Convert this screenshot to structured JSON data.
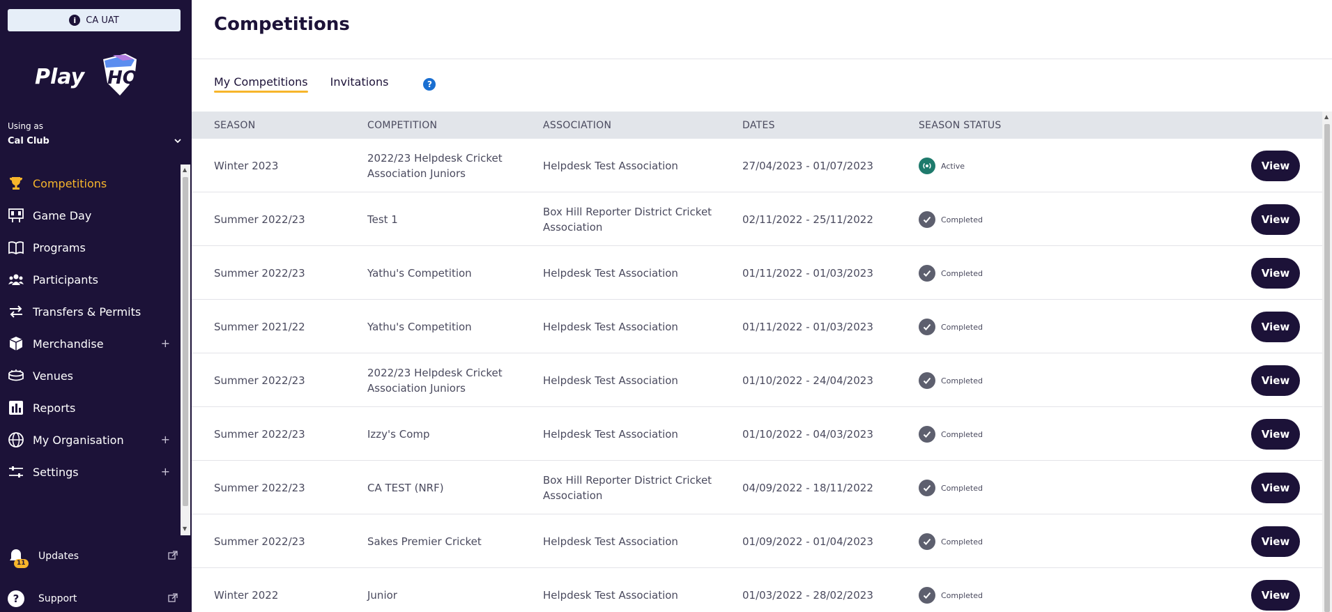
{
  "env": {
    "label": "CA UAT"
  },
  "brand": {
    "logo_text": "PlayHQ"
  },
  "account": {
    "using_as_label": "Using as",
    "club_name": "Cal Club"
  },
  "sidebar": {
    "items": [
      {
        "label": "Competitions",
        "icon": "trophy-icon",
        "active": true
      },
      {
        "label": "Game Day",
        "icon": "scoreboard-icon"
      },
      {
        "label": "Programs",
        "icon": "book-icon"
      },
      {
        "label": "Participants",
        "icon": "people-icon"
      },
      {
        "label": "Transfers & Permits",
        "icon": "transfer-arrows-icon"
      },
      {
        "label": "Merchandise",
        "icon": "boxes-icon",
        "expand": "+"
      },
      {
        "label": "Venues",
        "icon": "stadium-icon"
      },
      {
        "label": "Reports",
        "icon": "chart-icon"
      },
      {
        "label": "My Organisation",
        "icon": "globe-icon",
        "expand": "+"
      },
      {
        "label": "Settings",
        "icon": "sliders-icon",
        "expand": "+"
      }
    ],
    "bottom": {
      "updates_label": "Updates",
      "updates_count": "11",
      "support_label": "Support"
    }
  },
  "page": {
    "title": "Competitions",
    "tabs": [
      {
        "label": "My Competitions",
        "active": true
      },
      {
        "label": "Invitations"
      }
    ],
    "help_glyph": "?"
  },
  "table": {
    "headers": {
      "season": "SEASON",
      "competition": "COMPETITION",
      "association": "ASSOCIATION",
      "dates": "DATES",
      "status": "SEASON STATUS"
    },
    "view_label": "View",
    "rows": [
      {
        "season": "Winter 2023",
        "competition": "2022/23 Helpdesk Cricket Association Juniors",
        "association": "Helpdesk Test Association",
        "dates": "27/04/2023 - 01/07/2023",
        "status": "Active"
      },
      {
        "season": "Summer 2022/23",
        "competition": "Test 1",
        "association": "Box Hill Reporter District Cricket Association",
        "dates": "02/11/2022 - 25/11/2022",
        "status": "Completed"
      },
      {
        "season": "Summer 2022/23",
        "competition": "Yathu's Competition",
        "association": "Helpdesk Test Association",
        "dates": "01/11/2022 - 01/03/2023",
        "status": "Completed"
      },
      {
        "season": "Summer 2021/22",
        "competition": "Yathu's Competition",
        "association": "Helpdesk Test Association",
        "dates": "01/11/2022 - 01/03/2023",
        "status": "Completed"
      },
      {
        "season": "Summer 2022/23",
        "competition": "2022/23 Helpdesk Cricket Association Juniors",
        "association": "Helpdesk Test Association",
        "dates": "01/10/2022 - 24/04/2023",
        "status": "Completed"
      },
      {
        "season": "Summer 2022/23",
        "competition": "Izzy's Comp",
        "association": "Helpdesk Test Association",
        "dates": "01/10/2022 - 04/03/2023",
        "status": "Completed"
      },
      {
        "season": "Summer 2022/23",
        "competition": "CA TEST (NRF)",
        "association": "Box Hill Reporter District Cricket Association",
        "dates": "04/09/2022 - 18/11/2022",
        "status": "Completed"
      },
      {
        "season": "Summer 2022/23",
        "competition": "Sakes Premier Cricket",
        "association": "Helpdesk Test Association",
        "dates": "01/09/2022 - 01/04/2023",
        "status": "Completed"
      },
      {
        "season": "Winter 2022",
        "competition": "Junior",
        "association": "Helpdesk Test Association",
        "dates": "01/03/2022 - 28/02/2023",
        "status": "Completed"
      }
    ]
  },
  "colors": {
    "sidebar_bg": "#1c1238",
    "accent": "#f7b52b",
    "active_status": "#1e7a6c",
    "completed_status": "#5d5f6e",
    "help": "#1a6fd1"
  }
}
